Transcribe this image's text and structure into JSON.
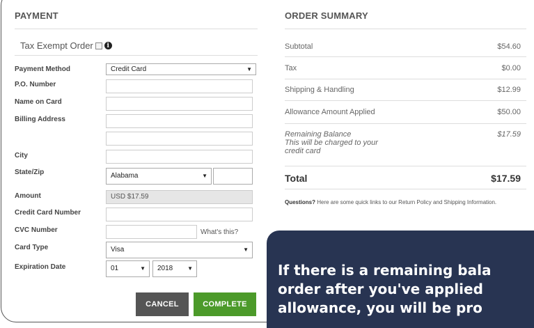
{
  "payment": {
    "title": "PAYMENT",
    "tax_exempt_label": "Tax Exempt Order",
    "fields": {
      "payment_method": {
        "label": "Payment Method",
        "value": "Credit Card"
      },
      "po_number": {
        "label": "P.O. Number",
        "value": ""
      },
      "name_on_card": {
        "label": "Name on Card",
        "value": ""
      },
      "billing_address": {
        "label": "Billing Address",
        "value": "",
        "value2": ""
      },
      "city": {
        "label": "City",
        "value": ""
      },
      "state_zip": {
        "label": "State/Zip",
        "state": "Alabama",
        "zip": ""
      },
      "amount": {
        "label": "Amount",
        "value": "USD $17.59"
      },
      "credit_card_number": {
        "label": "Credit Card Number",
        "value": ""
      },
      "cvc_number": {
        "label": "CVC Number",
        "value": "",
        "help_link": "What's this?"
      },
      "card_type": {
        "label": "Card Type",
        "value": "Visa"
      },
      "expiration_date": {
        "label": "Expiration Date",
        "month": "01",
        "year": "2018"
      }
    },
    "cancel_label": "CANCEL",
    "complete_label": "COMPLETE"
  },
  "summary": {
    "title": "ORDER SUMMARY",
    "rows": [
      {
        "label": "Subtotal",
        "value": "$54.60"
      },
      {
        "label": "Tax",
        "value": "$0.00"
      },
      {
        "label": "Shipping & Handling",
        "value": "$12.99"
      },
      {
        "label": "Allowance Amount Applied",
        "value": "$50.00"
      }
    ],
    "remaining": {
      "label_line1": "Remaining Balance",
      "label_line2": "This will be charged to your",
      "label_line3": "credit card",
      "value": "$17.59"
    },
    "total": {
      "label": "Total",
      "value": "$17.59"
    },
    "questions_bold": "Questions?",
    "questions_text": " Here are some quick links to our Return Policy and Shipping Information."
  },
  "callout": {
    "line1": "If there is a remaining bala",
    "line2": "order after you've applied",
    "line3": "allowance, you will be pro"
  },
  "colors": {
    "complete": "#4c9a2a",
    "cancel": "#555555",
    "callout_bg": "#283452"
  }
}
